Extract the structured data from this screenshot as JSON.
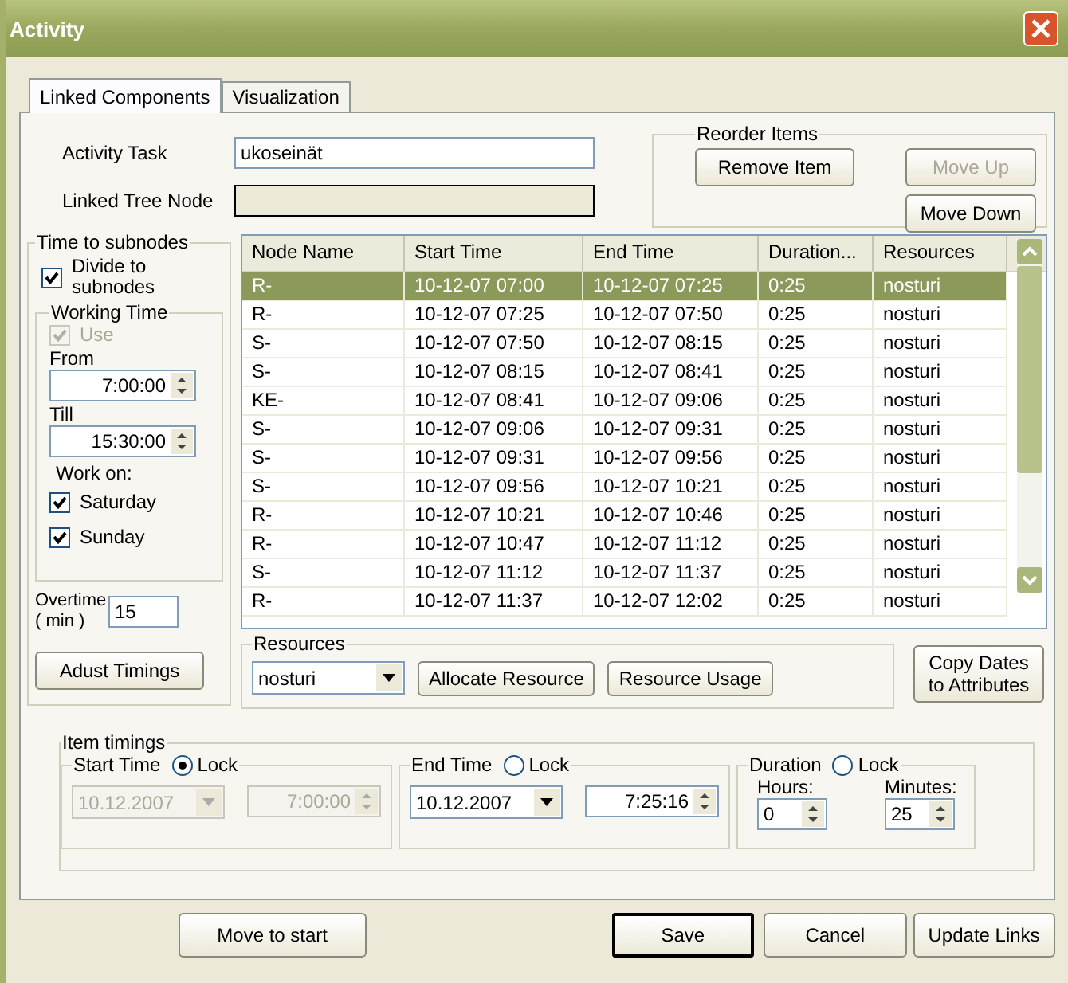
{
  "window": {
    "title": "Activity"
  },
  "tabs": [
    {
      "label": "Linked Components",
      "selected": true
    },
    {
      "label": "Visualization",
      "selected": false
    }
  ],
  "activity_task": {
    "label": "Activity Task",
    "value": "ukoseinät"
  },
  "linked_tree_node": {
    "label": "Linked Tree Node"
  },
  "reorder": {
    "title": "Reorder Items",
    "buttons": [
      {
        "label": "Remove Item",
        "disabled": false
      },
      {
        "label": "Move Up",
        "disabled": true
      },
      {
        "label": "Move Down",
        "disabled": false
      }
    ]
  },
  "time_to_subnodes": {
    "title": "Time to subnodes",
    "divide": {
      "label": "Divide to subnodes",
      "checked": true
    },
    "working_time": {
      "title": "Working Time",
      "use": {
        "label": "Use",
        "checked": true,
        "disabled": true
      },
      "from_label": "From",
      "from": "7:00:00",
      "till_label": "Till",
      "till": "15:30:00",
      "work_on_label": "Work on:",
      "days": [
        {
          "label": "Saturday",
          "checked": true
        },
        {
          "label": "Sunday",
          "checked": true
        }
      ]
    },
    "overtime_label": "Overtime ( min )",
    "overtime": "15",
    "adjust_button": "Adust Timings"
  },
  "table": {
    "columns": [
      "Node Name",
      "Start Time",
      "End Time",
      "Duration...",
      "Resources"
    ],
    "rows": [
      {
        "cells": [
          "R-",
          "10-12-07 07:00",
          "10-12-07 07:25",
          "0:25",
          "nosturi"
        ],
        "selected": true
      },
      {
        "cells": [
          "R-",
          "10-12-07 07:25",
          "10-12-07 07:50",
          "0:25",
          "nosturi"
        ],
        "selected": false
      },
      {
        "cells": [
          "S-",
          "10-12-07 07:50",
          "10-12-07 08:15",
          "0:25",
          "nosturi"
        ],
        "selected": false
      },
      {
        "cells": [
          "S-",
          "10-12-07 08:15",
          "10-12-07 08:41",
          "0:25",
          "nosturi"
        ],
        "selected": false
      },
      {
        "cells": [
          "KE-",
          "10-12-07 08:41",
          "10-12-07 09:06",
          "0:25",
          "nosturi"
        ],
        "selected": false
      },
      {
        "cells": [
          "S-",
          "10-12-07 09:06",
          "10-12-07 09:31",
          "0:25",
          "nosturi"
        ],
        "selected": false
      },
      {
        "cells": [
          "S-",
          "10-12-07 09:31",
          "10-12-07 09:56",
          "0:25",
          "nosturi"
        ],
        "selected": false
      },
      {
        "cells": [
          "S-",
          "10-12-07 09:56",
          "10-12-07 10:21",
          "0:25",
          "nosturi"
        ],
        "selected": false
      },
      {
        "cells": [
          "R-",
          "10-12-07 10:21",
          "10-12-07 10:46",
          "0:25",
          "nosturi"
        ],
        "selected": false
      },
      {
        "cells": [
          "R-",
          "10-12-07 10:47",
          "10-12-07 11:12",
          "0:25",
          "nosturi"
        ],
        "selected": false
      },
      {
        "cells": [
          "S-",
          "10-12-07 11:12",
          "10-12-07 11:37",
          "0:25",
          "nosturi"
        ],
        "selected": false
      },
      {
        "cells": [
          "R-",
          "10-12-07 11:37",
          "10-12-07 12:02",
          "0:25",
          "nosturi"
        ],
        "selected": false
      }
    ]
  },
  "resources": {
    "title": "Resources",
    "value": "nosturi",
    "buttons": [
      "Allocate Resource",
      "Resource Usage"
    ]
  },
  "copy_dates_button": "Copy Dates to Attributes",
  "item_timings": {
    "title": "Item timings",
    "start": {
      "label": "Start Time",
      "lock_label": "Lock",
      "locked": true,
      "date": "10.12.2007",
      "time": "7:00:00"
    },
    "end": {
      "label": "End Time",
      "lock_label": "Lock",
      "locked": false,
      "date": "10.12.2007",
      "time": "7:25:16"
    },
    "duration": {
      "label": "Duration",
      "lock_label": "Lock",
      "locked": false,
      "hours_label": "Hours:",
      "hours": "0",
      "minutes_label": "Minutes:",
      "minutes": "25"
    }
  },
  "footer_buttons": [
    {
      "label": "Move to start",
      "default": false
    },
    {
      "label": "Save",
      "default": true
    },
    {
      "label": "Cancel",
      "default": false
    },
    {
      "label": "Update Links",
      "default": false
    }
  ]
}
